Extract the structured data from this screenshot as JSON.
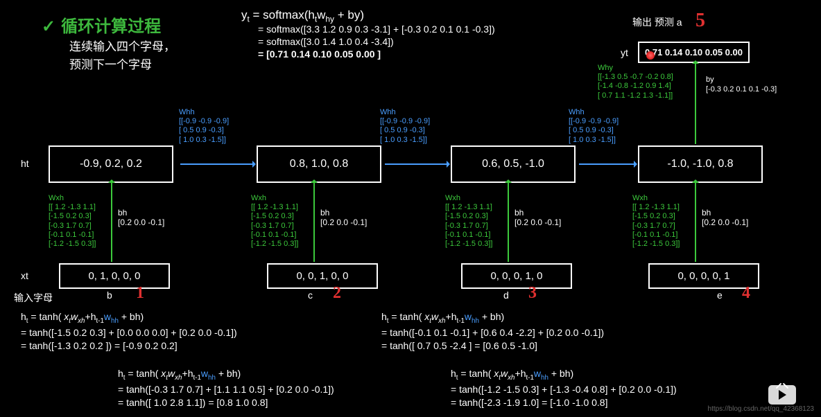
{
  "title": "循环计算过程",
  "subtitle_line1": "连续输入四个字母，",
  "subtitle_line2": "预测下一个字母",
  "formula": {
    "line1_pre": "y",
    "line1_sub": "t",
    "line1_rest": " = softmax(h",
    "line1_sub2": "t",
    "line1_rest2": "w",
    "line1_sub3": "hy",
    "line1_rest3": " + by)",
    "line2": "= softmax([3.3  1.2  0.9  0.3  -3.1] + [-0.3  0.2  0.1  0.1  -0.3])",
    "line3": "= softmax([3.0  1.4  1.0  0.4  -3.4])",
    "line4": "= [0.71  0.14  0.10  0.05  0.00 ]"
  },
  "output_label": "输出 预测    a",
  "red5": "5",
  "yt_label": "yt",
  "yt_box": "0.71 0.14 0.10 0.05 0.00",
  "why": {
    "label": "Why",
    "r1": "[[-1.3  0.5  -0.7  -0.2  0.8]",
    "r2": " [-1.4  -0.8  -1.2   0.9  1.4]",
    "r3": " [ 0.7  1.1  -1.2   1.3 -1.1]]"
  },
  "by": {
    "label": "by",
    "val": "[-0.3 0.2 0.1 0.1 -0.3]"
  },
  "ht_label": "ht",
  "xt_label": "xt",
  "input_letter_label": "输入字母",
  "whh": {
    "label": "Whh",
    "r1": "[[-0.9   -0.9  -0.9]",
    "r2": " [ 0.5    0.9  -0.3]",
    "r3": " [ 1.0    0.3  -1.5]]"
  },
  "wxh": {
    "label": "Wxh",
    "r1": "[[ 1.2  -1.3  1.1]",
    "r2": " [-1.5  0.2  0.3]",
    "r3": " [-0.3  1.7  0.7]",
    "r4": " [-0.1  0.1 -0.1]",
    "r5": " [-1.2 -1.5  0.3]]"
  },
  "bh": {
    "label": "bh",
    "val": "[0.2 0.0 -0.1]"
  },
  "steps": [
    {
      "ht": "-0.9,  0.2,  0.2",
      "xt": "0, 1, 0, 0, 0",
      "letter": "b",
      "num": "1"
    },
    {
      "ht": "0.8,  1.0,  0.8",
      "xt": "0, 0, 1, 0, 0",
      "letter": "c",
      "num": "2"
    },
    {
      "ht": "0.6,  0.5,  -1.0",
      "xt": "0, 0, 0, 1, 0",
      "letter": "d",
      "num": "3"
    },
    {
      "ht": "-1.0,  -1.0,  0.8",
      "xt": "0, 0, 0, 0, 1",
      "letter": "e",
      "num": "4"
    }
  ],
  "calcs": [
    {
      "pos": "a",
      "l1a": "h",
      "l1b": " = tanh( x",
      "l1c": "w",
      "l1d": "+h",
      "l1e": "w",
      "l1f": " + bh)",
      "l2": "  = tanh([-1.5  0.2  0.3] + [0.0  0.0  0.0] + [0.2  0.0  -0.1])",
      "l3": "  = tanh([-1.3  0.2  0.2 ]) = [-0.9  0.2  0.2]"
    },
    {
      "pos": "b",
      "l2": "  = tanh([-0.3 1.7 0.7] + [1.1 1.1 0.5] + [0.2  0.0  -0.1])",
      "l3": "  = tanh([ 1.0 2.8 1.1]) = [0.8  1.0  0.8]"
    },
    {
      "pos": "c",
      "l2": "  = tanh([-0.1  0.1  -0.1] + [0.6  0.4  -2.2] + [0.2  0.0  -0.1])",
      "l3": "  = tanh([ 0.7  0.5  -2.4 ] = [0.6  0.5  -1.0]"
    },
    {
      "pos": "d",
      "l2": "  = tanh([-1.2  -1.5   0.3] + [-1.3 -0.4  0.8] + [0.2  0.0  -0.1])",
      "l3": "  = tanh([-2.3  -1.9   1.0] = [-1.0  -1.0  0.8]"
    }
  ],
  "watermark": "https://blog.csdn.net/qq_42368123"
}
